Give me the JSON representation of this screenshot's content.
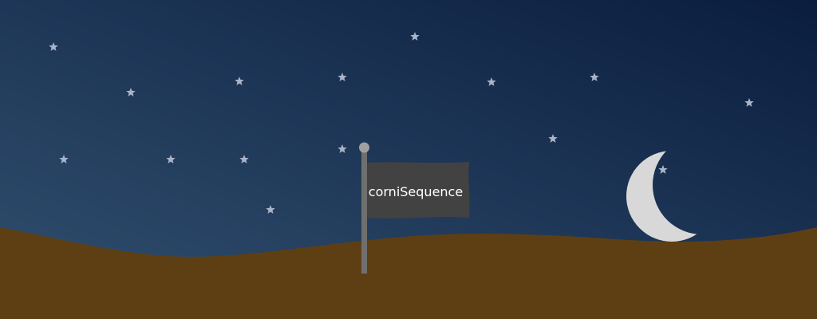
{
  "scene": {
    "flag_label": "corniSequence",
    "colors": {
      "sky_top": "#0b1f40",
      "sky_bottom": "#2f4b6c",
      "ground": "#5e3f14",
      "flag": "#424242",
      "pole": "#6f6f6f",
      "pole_cap": "#a0a0a0",
      "moon": "#d8d8d8",
      "star": "#aab4c8"
    },
    "icons": [
      "star-icon",
      "moon-icon",
      "flag-icon"
    ]
  }
}
